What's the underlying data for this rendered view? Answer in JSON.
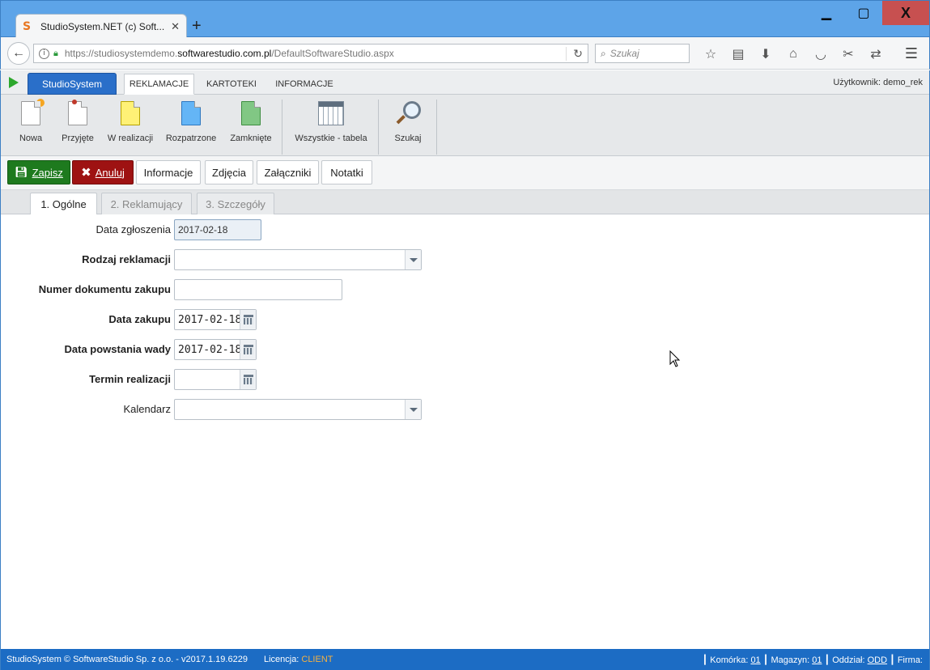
{
  "browser": {
    "tab_title": "StudioSystem.NET (c) Soft...",
    "tab_favicon": "S",
    "new_tab": "+",
    "url_prefix": "https://studiosystemdemo.",
    "url_domain": "softwarestudio.com.pl",
    "url_path": "/DefaultSoftwareStudio.aspx",
    "search_placeholder": "Szukaj",
    "window_close": "X"
  },
  "app_menu": {
    "brand": "StudioSystem",
    "tabs": [
      "REKLAMACJE",
      "KARTOTEKI",
      "INFORMACJE"
    ],
    "active_tab": "REKLAMACJE",
    "user_label": "Użytkownik: demo_rek"
  },
  "ribbon": {
    "items": [
      {
        "label": "Nowa",
        "icon": "new-document-icon",
        "color": "#ffffff"
      },
      {
        "label": "Przyjęte",
        "icon": "accepted-document-icon",
        "color": "#ffffff"
      },
      {
        "label": "W realizacji",
        "icon": "in-progress-document-icon",
        "color": "#fff176"
      },
      {
        "label": "Rozpatrzone",
        "icon": "reviewed-document-icon",
        "color": "#64b5f6"
      },
      {
        "label": "Zamknięte",
        "icon": "closed-document-icon",
        "color": "#81c784"
      },
      {
        "label": "Wszystkie - tabela",
        "icon": "calendar-table-icon"
      },
      {
        "label": "Szukaj",
        "icon": "magnifier-icon"
      }
    ]
  },
  "actions": {
    "save": "Zapisz",
    "cancel": "Anuluj",
    "info": "Informacje",
    "photos": "Zdjęcia",
    "attachments": "Załączniki",
    "notes": "Notatki"
  },
  "form_tabs": [
    "1. Ogólne",
    "2. Reklamujący",
    "3. Szczegóły"
  ],
  "form": {
    "date_reported_label": "Data zgłoszenia",
    "date_reported_value": "2017-02-18",
    "complaint_type_label": "Rodzaj reklamacji",
    "complaint_type_value": "",
    "purchase_doc_label": "Numer dokumentu zakupu",
    "purchase_doc_value": "",
    "purchase_date_label": "Data zakupu",
    "purchase_date_value": "2017-02-18",
    "defect_date_label": "Data powstania wady",
    "defect_date_value": "2017-02-18",
    "deadline_label": "Termin realizacji",
    "deadline_value": "",
    "calendar_label": "Kalendarz",
    "calendar_value": ""
  },
  "status": {
    "copyright": "StudioSystem © SoftwareStudio Sp. z o.o. - v2017.1.19.6229",
    "license_label": "Licencja:",
    "license_value": "CLIENT",
    "cell_label": "Komórka:",
    "cell_value": "01",
    "warehouse_label": "Magazyn:",
    "warehouse_value": "01",
    "branch_label": "Oddział:",
    "branch_value": "ODD",
    "company_label": "Firma:"
  },
  "colors": {
    "brand_blue": "#2a6fc9",
    "save_green": "#1e7a1e",
    "cancel_red": "#9e1212",
    "status_blue": "#1c6cc4",
    "license_orange": "#f5b041"
  }
}
